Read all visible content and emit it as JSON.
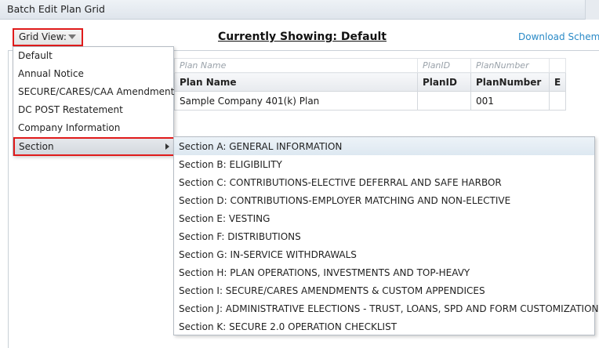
{
  "window": {
    "title": "Batch Edit Plan Grid"
  },
  "toolbar": {
    "grid_view_label": "Grid View:",
    "currently_showing": "Currently Showing: Default",
    "download_link": "Download Schema"
  },
  "grid": {
    "filter_placeholders": [
      "Plan Name",
      "PlanID",
      "PlanNumber"
    ],
    "columns": [
      "Plan Name",
      "PlanID",
      "PlanNumber",
      "E"
    ],
    "rows": [
      {
        "plan_name": "Sample Company 401(k) Plan",
        "plan_id": "",
        "plan_number": "001"
      }
    ]
  },
  "grid_view_menu": {
    "items": [
      "Default",
      "Annual Notice",
      "SECURE/CARES/CAA Amendment",
      "DC POST Restatement",
      "Company Information",
      "Section"
    ]
  },
  "section_submenu": {
    "items": [
      "Section A: GENERAL INFORMATION",
      "Section B: ELIGIBILITY",
      "Section C: CONTRIBUTIONS-ELECTIVE DEFERRAL AND SAFE HARBOR",
      "Section D: CONTRIBUTIONS-EMPLOYER MATCHING AND NON-ELECTIVE",
      "Section E: VESTING",
      "Section F: DISTRIBUTIONS",
      "Section G: IN-SERVICE WITHDRAWALS",
      "Section H: PLAN OPERATIONS, INVESTMENTS AND TOP-HEAVY",
      "Section I: SECURE/CARES AMENDMENTS & CUSTOM APPENDICES",
      "Section J: ADMINISTRATIVE ELECTIONS - TRUST, LOANS, SPD AND FORM CUSTOMIZATIONS",
      "Section K: SECURE 2.0 OPERATION CHECKLIST"
    ]
  },
  "colors": {
    "highlight_border": "#e01b1b",
    "link": "#2a8ac7"
  }
}
